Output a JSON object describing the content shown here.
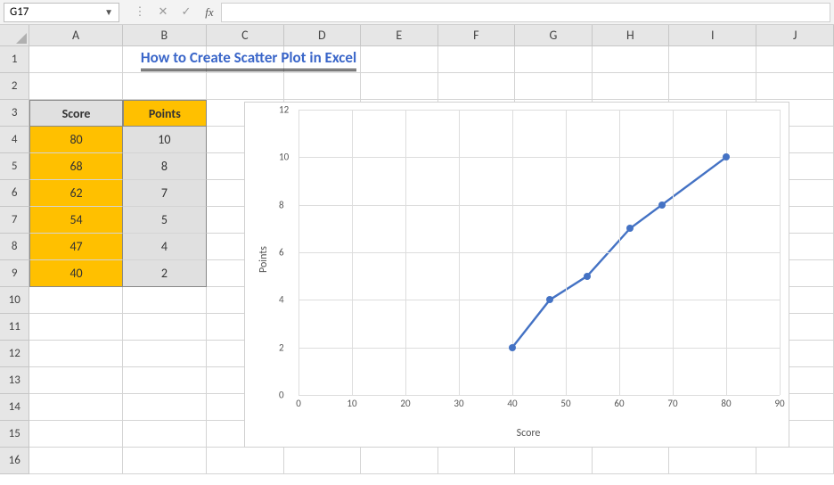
{
  "name_box": "G17",
  "formula_value": "",
  "columns": [
    "A",
    "B",
    "C",
    "D",
    "E",
    "F",
    "G",
    "H",
    "I",
    "J"
  ],
  "row_count": 16,
  "title": "How to Create Scatter Plot in Excel",
  "table": {
    "headers": {
      "score": "Score",
      "points": "Points"
    },
    "rows": [
      {
        "score": "80",
        "points": "10"
      },
      {
        "score": "68",
        "points": "8"
      },
      {
        "score": "62",
        "points": "7"
      },
      {
        "score": "54",
        "points": "5"
      },
      {
        "score": "47",
        "points": "4"
      },
      {
        "score": "40",
        "points": "2"
      }
    ]
  },
  "chart_data": {
    "type": "scatter",
    "x": [
      80,
      68,
      62,
      54,
      47,
      40
    ],
    "y": [
      10,
      8,
      7,
      5,
      4,
      2
    ],
    "xlabel": "Score",
    "ylabel": "Points",
    "xlim": [
      0,
      90
    ],
    "ylim": [
      0,
      12
    ],
    "xticks": [
      0,
      10,
      20,
      30,
      40,
      50,
      60,
      70,
      80,
      90
    ],
    "yticks": [
      0,
      2,
      4,
      6,
      8,
      10,
      12
    ],
    "line_color": "#4472c4"
  }
}
